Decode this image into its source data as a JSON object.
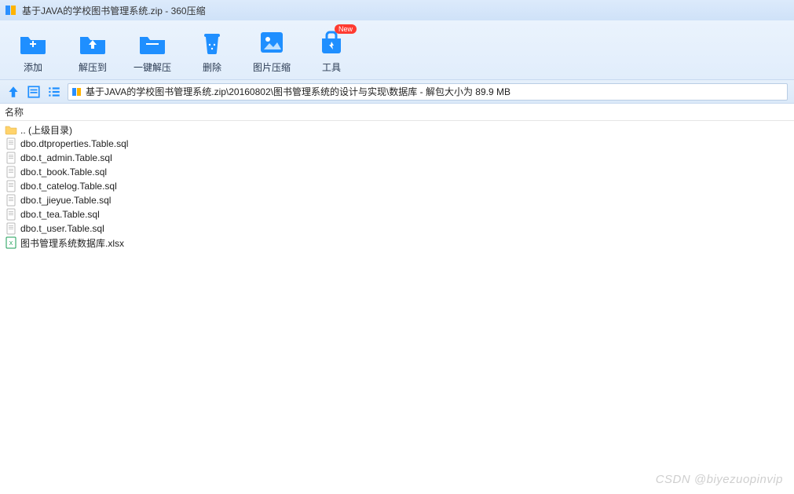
{
  "window": {
    "title": "基于JAVA的学校图书管理系统.zip - 360压缩"
  },
  "toolbar": {
    "add": "添加",
    "extract_to": "解压到",
    "one_click": "一键解压",
    "delete": "删除",
    "image_compress": "图片压缩",
    "tools": "工具",
    "new_badge": "New"
  },
  "path": {
    "text": "基于JAVA的学校图书管理系统.zip\\20160802\\图书管理系统的设计与实现\\数据库 - 解包大小为 89.9 MB"
  },
  "columns": {
    "name": "名称"
  },
  "files": [
    {
      "name": ".. (上级目录)",
      "type": "folder"
    },
    {
      "name": "dbo.dtproperties.Table.sql",
      "type": "sql"
    },
    {
      "name": "dbo.t_admin.Table.sql",
      "type": "sql"
    },
    {
      "name": "dbo.t_book.Table.sql",
      "type": "sql"
    },
    {
      "name": "dbo.t_catelog.Table.sql",
      "type": "sql"
    },
    {
      "name": "dbo.t_jieyue.Table.sql",
      "type": "sql"
    },
    {
      "name": "dbo.t_tea.Table.sql",
      "type": "sql"
    },
    {
      "name": "dbo.t_user.Table.sql",
      "type": "sql"
    },
    {
      "name": "图书管理系统数据库.xlsx",
      "type": "xlsx"
    }
  ],
  "watermark": "CSDN @biyezuopinvip"
}
